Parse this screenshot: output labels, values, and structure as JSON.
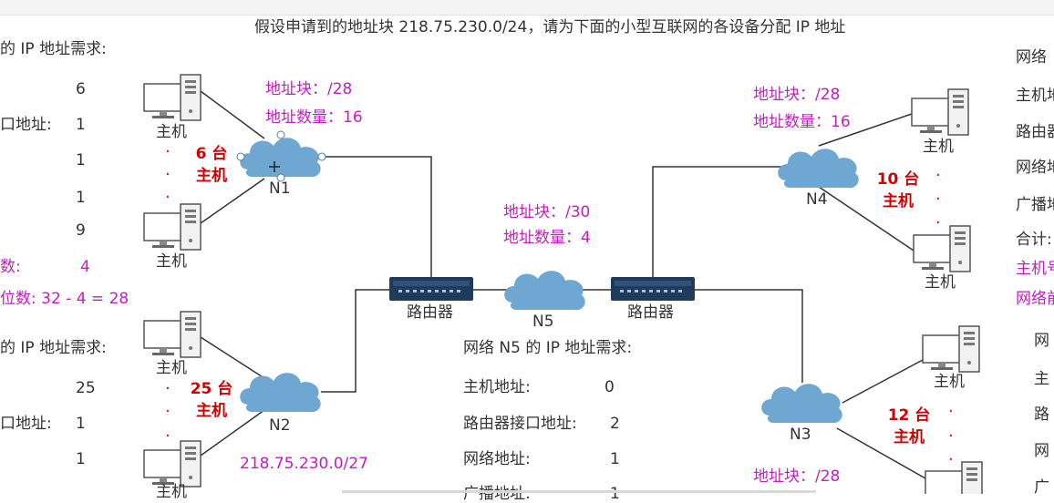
{
  "title": "假设申请到的地址块 218.75.230.0/24，请为下面的小型互联网的各设备分配 IP 地址",
  "colors": {
    "cloud": "#6fa7d3",
    "router": "#1f3a5a",
    "magenta": "#c21ec2",
    "red": "#d00000"
  },
  "left_panel": {
    "n1_heading": "的 IP 地址需求:",
    "n1_hosts": "6",
    "n1_router_label": "口地址:",
    "n1_router_val": "1",
    "n1_val3": "1",
    "n1_val4": "1",
    "n1_total": "9",
    "n1_hostbits_label": "数:",
    "n1_hostbits_val": "4",
    "n1_formula": "位数:  32 - 4 = 28",
    "n2_heading": "的 IP 地址需求:",
    "n2_hosts": "25",
    "n2_router_label": "口地址:",
    "n2_router_val": "1",
    "n2_val3": "1"
  },
  "right_panel": {
    "l1": "网络",
    "l2": "主机地",
    "l3": "路由器",
    "l4": "网络地",
    "l5": "广播地",
    "l6": "合计:",
    "l7": "主机号",
    "l8": "网络前",
    "l9": "网",
    "l10": "主",
    "l11": "路",
    "l12": "网",
    "l13": "广"
  },
  "n1": {
    "block": "地址块：/28",
    "count": "地址数量：16",
    "name": "N1",
    "hosts_line1": "6 台",
    "hosts_line2": "主机",
    "host_top": "主机",
    "host_bottom": "主机"
  },
  "n2": {
    "name": "N2",
    "hosts_line1": "25 台",
    "hosts_line2": "主机",
    "host_top": "主机",
    "host_bottom": "主机",
    "assigned": "218.75.230.0/27"
  },
  "n3": {
    "name": "N3",
    "hosts_line1": "12 台",
    "hosts_line2": "主机",
    "host_top": "主机",
    "block": "地址块：/28"
  },
  "n4": {
    "block": "地址块：/28",
    "count": "地址数量：16",
    "name": "N4",
    "hosts_line1": "10 台",
    "hosts_line2": "主机",
    "host_top": "主机",
    "host_bottom": "主机"
  },
  "n5": {
    "block": "地址块：/30",
    "count": "地址数量：4",
    "name": "N5",
    "req_heading": "网络 N5 的 IP 地址需求:",
    "rows": [
      {
        "label": "主机地址:",
        "value": "0"
      },
      {
        "label": "路由器接口地址:",
        "value": "2"
      },
      {
        "label": "网络地址:",
        "value": "1"
      },
      {
        "label": "广播地址:",
        "value": "1"
      }
    ]
  },
  "routers": {
    "left": "路由器",
    "right": "路由器"
  }
}
